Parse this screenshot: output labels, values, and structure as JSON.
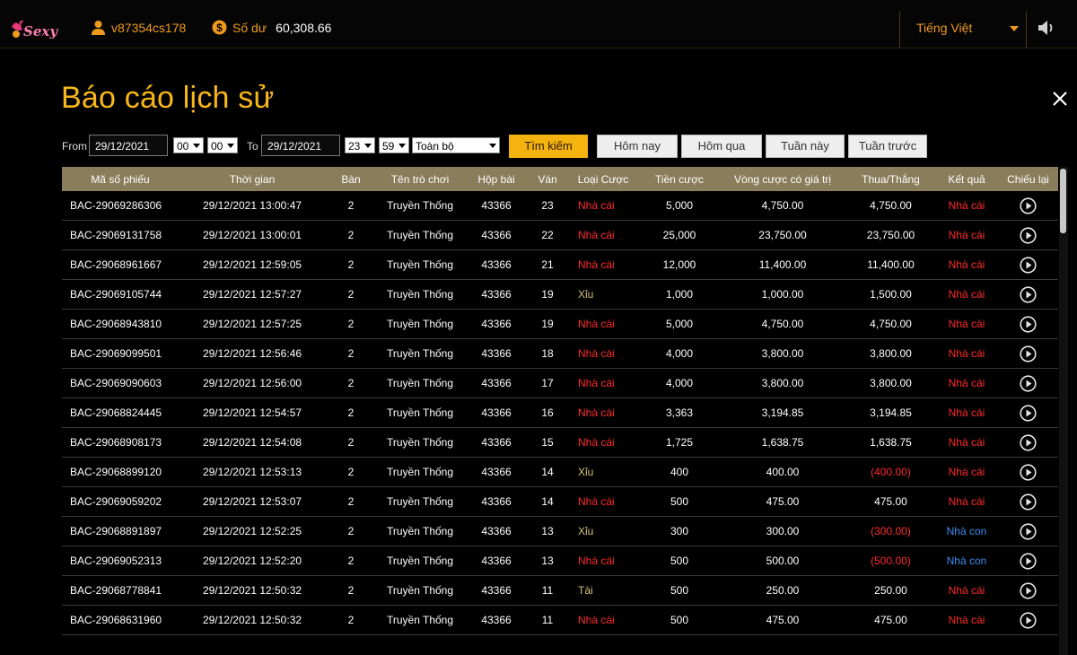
{
  "header": {
    "logo_text": "Sexy",
    "username": "v87354cs178",
    "balance_label": "Số dư",
    "balance_value": "60,308.66",
    "language": "Tiếng Việt"
  },
  "panel": {
    "title": "Báo cáo lịch sử"
  },
  "filters": {
    "from_label": "From",
    "from_date": "29/12/2021",
    "from_hour": "00",
    "from_minute": "00",
    "to_label": "To",
    "to_date": "29/12/2021",
    "to_hour": "23",
    "to_minute": "59",
    "scope": "Toàn bộ",
    "search_label": "Tìm kiếm",
    "today_label": "Hôm nay",
    "yesterday_label": "Hôm qua",
    "this_week_label": "Tuần này",
    "last_week_label": "Tuần trước"
  },
  "table": {
    "columns": [
      "Mã số phiếu",
      "Thời gian",
      "Bàn",
      "Tên trò chơi",
      "Hộp bài",
      "Ván",
      "Loại Cược",
      "Tiền cược",
      "Vòng cược có giá trị",
      "Thua/Thắng",
      "Kết quả",
      "Chiếu lại"
    ],
    "rows": [
      {
        "ticket": "BAC-29069286306",
        "time": "29/12/2021 13:00:47",
        "table": "2",
        "game": "Truyền Thống",
        "shoe": "43366",
        "round": "23",
        "bet_type": "Nhà cái",
        "stake": "5,000",
        "valid": "4,750.00",
        "winloss": "4,750.00",
        "result": "Nhà cái"
      },
      {
        "ticket": "BAC-29069131758",
        "time": "29/12/2021 13:00:01",
        "table": "2",
        "game": "Truyền Thống",
        "shoe": "43366",
        "round": "22",
        "bet_type": "Nhà cái",
        "stake": "25,000",
        "valid": "23,750.00",
        "winloss": "23,750.00",
        "result": "Nhà cái"
      },
      {
        "ticket": "BAC-29068961667",
        "time": "29/12/2021 12:59:05",
        "table": "2",
        "game": "Truyền Thống",
        "shoe": "43366",
        "round": "21",
        "bet_type": "Nhà cái",
        "stake": "12,000",
        "valid": "11,400.00",
        "winloss": "11,400.00",
        "result": "Nhà cái"
      },
      {
        "ticket": "BAC-29069105744",
        "time": "29/12/2021 12:57:27",
        "table": "2",
        "game": "Truyền Thống",
        "shoe": "43366",
        "round": "19",
        "bet_type": "Xỉu",
        "stake": "1,000",
        "valid": "1,000.00",
        "winloss": "1,500.00",
        "result": "Nhà cái"
      },
      {
        "ticket": "BAC-29068943810",
        "time": "29/12/2021 12:57:25",
        "table": "2",
        "game": "Truyền Thống",
        "shoe": "43366",
        "round": "19",
        "bet_type": "Nhà cái",
        "stake": "5,000",
        "valid": "4,750.00",
        "winloss": "4,750.00",
        "result": "Nhà cái"
      },
      {
        "ticket": "BAC-29069099501",
        "time": "29/12/2021 12:56:46",
        "table": "2",
        "game": "Truyền Thống",
        "shoe": "43366",
        "round": "18",
        "bet_type": "Nhà cái",
        "stake": "4,000",
        "valid": "3,800.00",
        "winloss": "3,800.00",
        "result": "Nhà cái"
      },
      {
        "ticket": "BAC-29069090603",
        "time": "29/12/2021 12:56:00",
        "table": "2",
        "game": "Truyền Thống",
        "shoe": "43366",
        "round": "17",
        "bet_type": "Nhà cái",
        "stake": "4,000",
        "valid": "3,800.00",
        "winloss": "3,800.00",
        "result": "Nhà cái"
      },
      {
        "ticket": "BAC-29068824445",
        "time": "29/12/2021 12:54:57",
        "table": "2",
        "game": "Truyền Thống",
        "shoe": "43366",
        "round": "16",
        "bet_type": "Nhà cái",
        "stake": "3,363",
        "valid": "3,194.85",
        "winloss": "3,194.85",
        "result": "Nhà cái"
      },
      {
        "ticket": "BAC-29068908173",
        "time": "29/12/2021 12:54:08",
        "table": "2",
        "game": "Truyền Thống",
        "shoe": "43366",
        "round": "15",
        "bet_type": "Nhà cái",
        "stake": "1,725",
        "valid": "1,638.75",
        "winloss": "1,638.75",
        "result": "Nhà cái"
      },
      {
        "ticket": "BAC-29068899120",
        "time": "29/12/2021 12:53:13",
        "table": "2",
        "game": "Truyền Thống",
        "shoe": "43366",
        "round": "14",
        "bet_type": "Xỉu",
        "stake": "400",
        "valid": "400.00",
        "winloss": "(400.00)",
        "result": "Nhà cái"
      },
      {
        "ticket": "BAC-29069059202",
        "time": "29/12/2021 12:53:07",
        "table": "2",
        "game": "Truyền Thống",
        "shoe": "43366",
        "round": "14",
        "bet_type": "Nhà cái",
        "stake": "500",
        "valid": "475.00",
        "winloss": "475.00",
        "result": "Nhà cái"
      },
      {
        "ticket": "BAC-29068891897",
        "time": "29/12/2021 12:52:25",
        "table": "2",
        "game": "Truyền Thống",
        "shoe": "43366",
        "round": "13",
        "bet_type": "Xỉu",
        "stake": "300",
        "valid": "300.00",
        "winloss": "(300.00)",
        "result": "Nhà con"
      },
      {
        "ticket": "BAC-29069052313",
        "time": "29/12/2021 12:52:20",
        "table": "2",
        "game": "Truyền Thống",
        "shoe": "43366",
        "round": "13",
        "bet_type": "Nhà cái",
        "stake": "500",
        "valid": "500.00",
        "winloss": "(500.00)",
        "result": "Nhà con"
      },
      {
        "ticket": "BAC-29068778841",
        "time": "29/12/2021 12:50:32",
        "table": "2",
        "game": "Truyền Thống",
        "shoe": "43366",
        "round": "11",
        "bet_type": "Tài",
        "stake": "500",
        "valid": "250.00",
        "winloss": "250.00",
        "result": "Nhà cái"
      },
      {
        "ticket": "BAC-29068631960",
        "time": "29/12/2021 12:50:32",
        "table": "2",
        "game": "Truyền Thống",
        "shoe": "43366",
        "round": "11",
        "bet_type": "Nhà cái",
        "stake": "500",
        "valid": "475.00",
        "winloss": "475.00",
        "result": "Nhà cái"
      }
    ]
  },
  "colors": {
    "accent": "#f09a1d",
    "title": "#f7b61a",
    "header_row": "#8a7d5c",
    "red": "#ff2a2a",
    "blue": "#3d8ef0"
  },
  "icons": [
    "user-icon",
    "dollar-icon",
    "chevron-down-icon",
    "speaker-icon",
    "close-icon",
    "play-icon"
  ]
}
